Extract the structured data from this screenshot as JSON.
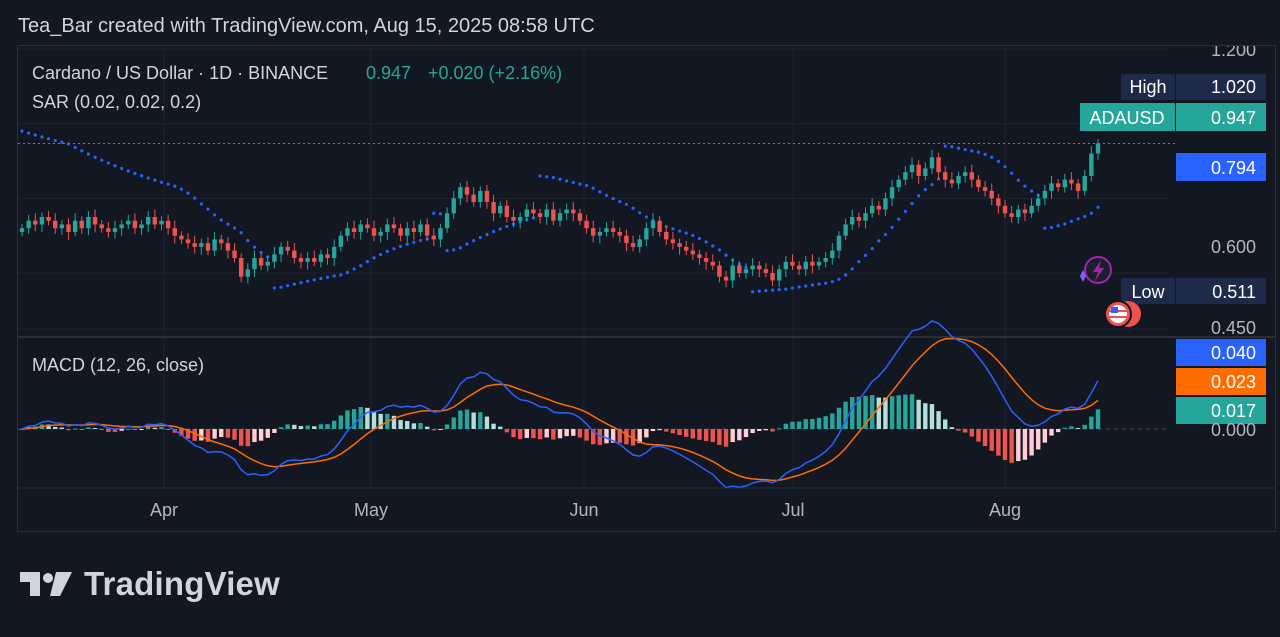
{
  "credit": "Tea_Bar created with TradingView.com, Aug 15, 2025 08:58 UTC",
  "footer": {
    "brand": "TradingView"
  },
  "colors": {
    "background": "#131722",
    "up": "#26a69a",
    "down": "#ef5350",
    "sar": "#2962ff",
    "macd_line": "#2962ff",
    "signal_line": "#ff6d00",
    "grid": "#1f2330"
  },
  "chart_data": [
    {
      "type": "candlestick",
      "title": "Cardano / US Dollar · 1D · BINANCE",
      "symbol": "ADAUSD",
      "last_price": "0.947",
      "change": "+0.020 (+2.16%)",
      "indicator": "SAR (0.02, 0.02, 0.2)",
      "y_ticks": [
        "1.200",
        "0.600",
        "0.450"
      ],
      "ylim": [
        0.45,
        1.2
      ],
      "x_ticks": [
        "Apr",
        "May",
        "Jun",
        "Jul",
        "Aug"
      ],
      "price_labels": {
        "high_label": "High",
        "high": "1.020",
        "last_label": "ADAUSD",
        "last": "0.947",
        "sar": "0.794",
        "low_label": "Low",
        "low": "0.511"
      },
      "closes": [
        0.72,
        0.74,
        0.73,
        0.75,
        0.74,
        0.72,
        0.73,
        0.71,
        0.74,
        0.72,
        0.75,
        0.73,
        0.72,
        0.71,
        0.72,
        0.73,
        0.74,
        0.72,
        0.73,
        0.75,
        0.73,
        0.74,
        0.72,
        0.7,
        0.69,
        0.68,
        0.67,
        0.68,
        0.66,
        0.69,
        0.68,
        0.66,
        0.64,
        0.59,
        0.61,
        0.64,
        0.62,
        0.63,
        0.65,
        0.67,
        0.66,
        0.64,
        0.63,
        0.64,
        0.63,
        0.65,
        0.64,
        0.67,
        0.7,
        0.72,
        0.71,
        0.73,
        0.72,
        0.7,
        0.71,
        0.73,
        0.72,
        0.7,
        0.72,
        0.71,
        0.73,
        0.7,
        0.69,
        0.72,
        0.76,
        0.8,
        0.83,
        0.81,
        0.79,
        0.82,
        0.79,
        0.76,
        0.78,
        0.75,
        0.74,
        0.75,
        0.77,
        0.76,
        0.75,
        0.77,
        0.74,
        0.76,
        0.77,
        0.76,
        0.74,
        0.72,
        0.7,
        0.71,
        0.72,
        0.71,
        0.7,
        0.68,
        0.67,
        0.69,
        0.72,
        0.74,
        0.71,
        0.69,
        0.68,
        0.67,
        0.66,
        0.65,
        0.64,
        0.63,
        0.62,
        0.59,
        0.58,
        0.62,
        0.6,
        0.61,
        0.62,
        0.61,
        0.6,
        0.58,
        0.61,
        0.63,
        0.62,
        0.61,
        0.63,
        0.62,
        0.63,
        0.64,
        0.66,
        0.7,
        0.73,
        0.75,
        0.74,
        0.76,
        0.78,
        0.77,
        0.8,
        0.83,
        0.85,
        0.87,
        0.89,
        0.86,
        0.88,
        0.91,
        0.87,
        0.85,
        0.84,
        0.86,
        0.87,
        0.85,
        0.83,
        0.82,
        0.8,
        0.78,
        0.76,
        0.75,
        0.77,
        0.76,
        0.78,
        0.8,
        0.82,
        0.84,
        0.83,
        0.85,
        0.84,
        0.82,
        0.86,
        0.92,
        0.947
      ],
      "sar_start": [
        0.98,
        0.94
      ],
      "macd_ticks": [
        "0.040",
        "0.023",
        "0.017",
        "0.000"
      ],
      "macd_ylim": [
        -0.03,
        0.045
      ],
      "macd": {
        "indicator": "MACD (12, 26, close)",
        "macd": "0.040",
        "signal": "0.023",
        "histogram": "0.017"
      }
    }
  ]
}
